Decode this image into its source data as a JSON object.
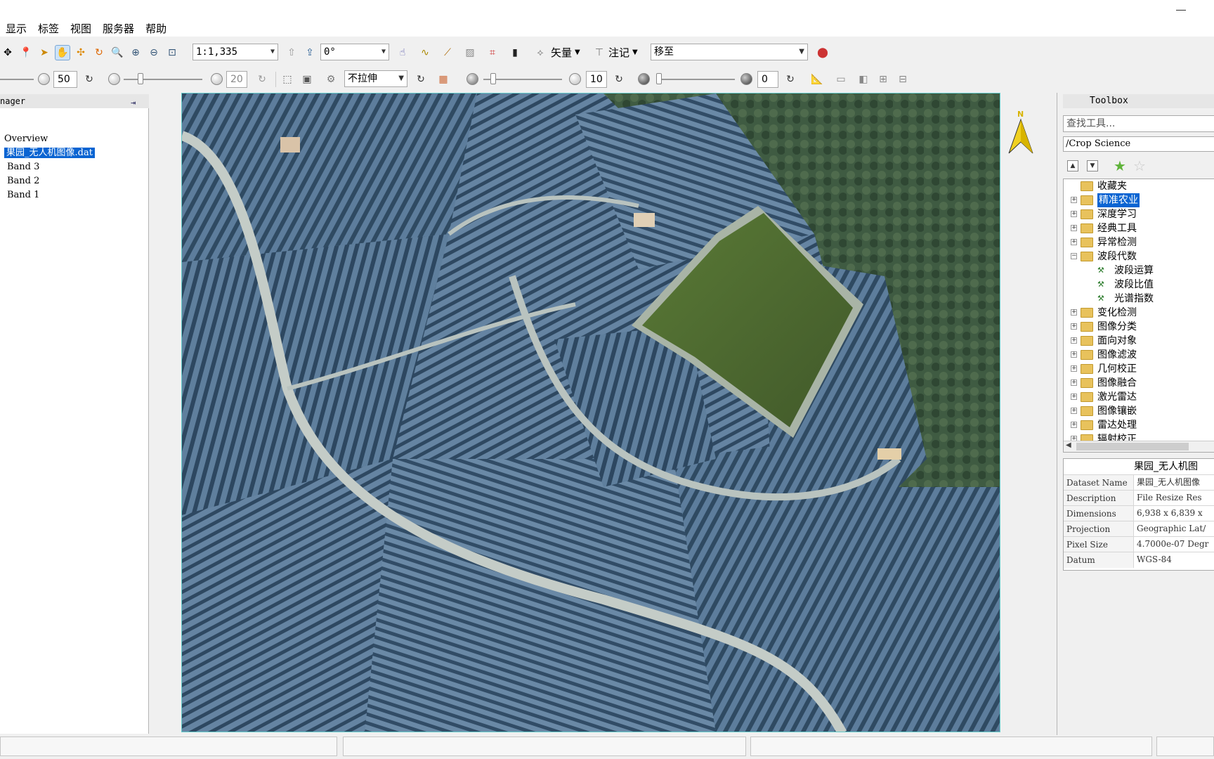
{
  "menu": [
    "显示",
    "标签",
    "视图",
    "服务器",
    "帮助"
  ],
  "toolbar1": {
    "scale": "1:1,335",
    "rotation": "0°",
    "vector_label": "矢量",
    "annotation_label": "注记",
    "goto_value": "移至"
  },
  "toolbar2": {
    "brightness": "50",
    "contrast": "20",
    "stretch": "不拉伸",
    "sharpen": "10",
    "transparency": "0"
  },
  "layer_manager": {
    "header": "nager",
    "items": [
      {
        "label": "Overview"
      },
      {
        "label": "果园_无人机图像.dat"
      },
      {
        "label": "Band 3"
      },
      {
        "label": "Band 2"
      },
      {
        "label": "Band 1"
      }
    ]
  },
  "north_label": "N",
  "toolbox": {
    "header": "Toolbox",
    "search_placeholder": "查找工具...",
    "path": "/Crop Science",
    "tree": [
      {
        "label": "收藏夹",
        "level": 0,
        "type": "folder",
        "expander": ""
      },
      {
        "label": "精准农业",
        "level": 0,
        "type": "folder",
        "expander": "+",
        "selected": true
      },
      {
        "label": "深度学习",
        "level": 0,
        "type": "folder",
        "expander": "+"
      },
      {
        "label": "经典工具",
        "level": 0,
        "type": "folder",
        "expander": "+"
      },
      {
        "label": "异常检测",
        "level": 0,
        "type": "folder",
        "expander": "+"
      },
      {
        "label": "波段代数",
        "level": 0,
        "type": "folder",
        "expander": "−"
      },
      {
        "label": "波段运算",
        "level": 1,
        "type": "tool"
      },
      {
        "label": "波段比值",
        "level": 1,
        "type": "tool"
      },
      {
        "label": "光谱指数",
        "level": 1,
        "type": "tool"
      },
      {
        "label": "变化检测",
        "level": 0,
        "type": "folder",
        "expander": "+"
      },
      {
        "label": "图像分类",
        "level": 0,
        "type": "folder",
        "expander": "+"
      },
      {
        "label": "面向对象",
        "level": 0,
        "type": "folder",
        "expander": "+"
      },
      {
        "label": "图像滤波",
        "level": 0,
        "type": "folder",
        "expander": "+"
      },
      {
        "label": "几何校正",
        "level": 0,
        "type": "folder",
        "expander": "+"
      },
      {
        "label": "图像融合",
        "level": 0,
        "type": "folder",
        "expander": "+"
      },
      {
        "label": "激光雷达",
        "level": 0,
        "type": "folder",
        "expander": "+"
      },
      {
        "label": "图像镶嵌",
        "level": 0,
        "type": "folder",
        "expander": "+"
      },
      {
        "label": "雷达处理",
        "level": 0,
        "type": "folder",
        "expander": "+"
      },
      {
        "label": "辐射校正",
        "level": 0,
        "type": "folder",
        "expander": "+"
      }
    ]
  },
  "properties": {
    "title": "果园_无人机图",
    "rows": [
      {
        "key": "Dataset Name",
        "value": "果园_无人机图像"
      },
      {
        "key": "Description",
        "value": "File Resize Res"
      },
      {
        "key": "Dimensions",
        "value": "6,938 x 6,839 x"
      },
      {
        "key": "Projection",
        "value": "Geographic Lat/"
      },
      {
        "key": "Pixel Size",
        "value": "4.7000e-07 Degr"
      },
      {
        "key": "Datum",
        "value": "WGS-84"
      }
    ]
  },
  "colors": {
    "selection": "#0a64d2",
    "orchard": "#4f6f8c",
    "pond": "#4e6b2e",
    "forest": "#3d5a3c"
  }
}
